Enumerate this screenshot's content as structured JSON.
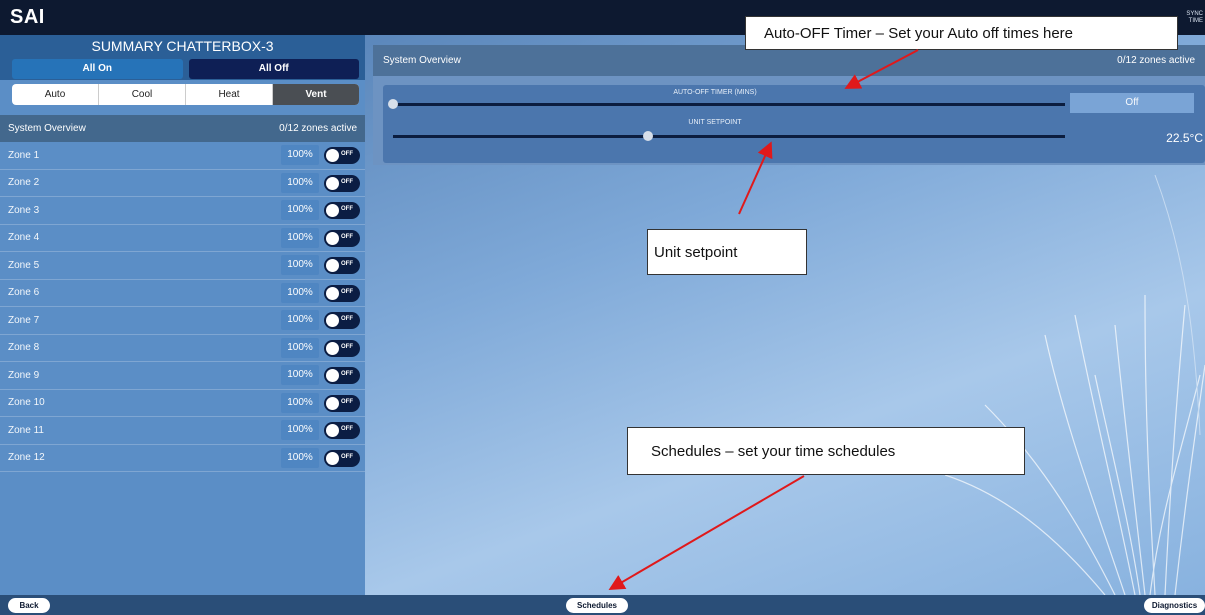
{
  "header": {
    "logo_text": "SAI",
    "brand_right": "SYNC\nTIME"
  },
  "sidebar": {
    "title": "SUMMARY CHATTERBOX-3",
    "all_on_label": "All On",
    "all_off_label": "All Off",
    "modes": [
      "Auto",
      "Cool",
      "Heat",
      "Vent"
    ],
    "active_mode": "Vent",
    "overview_label": "System Overview",
    "overview_status": "0/12 zones active",
    "zones": [
      {
        "name": "Zone 1",
        "percent": "100%",
        "state": "OFF"
      },
      {
        "name": "Zone 2",
        "percent": "100%",
        "state": "OFF"
      },
      {
        "name": "Zone 3",
        "percent": "100%",
        "state": "OFF"
      },
      {
        "name": "Zone 4",
        "percent": "100%",
        "state": "OFF"
      },
      {
        "name": "Zone 5",
        "percent": "100%",
        "state": "OFF"
      },
      {
        "name": "Zone 6",
        "percent": "100%",
        "state": "OFF"
      },
      {
        "name": "Zone 7",
        "percent": "100%",
        "state": "OFF"
      },
      {
        "name": "Zone 8",
        "percent": "100%",
        "state": "OFF"
      },
      {
        "name": "Zone 9",
        "percent": "100%",
        "state": "OFF"
      },
      {
        "name": "Zone 10",
        "percent": "100%",
        "state": "OFF"
      },
      {
        "name": "Zone 11",
        "percent": "100%",
        "state": "OFF"
      },
      {
        "name": "Zone 12",
        "percent": "100%",
        "state": "OFF"
      }
    ]
  },
  "main": {
    "overview_label": "System Overview",
    "overview_status": "0/12 zones active",
    "auto_off_label": "AUTO-OFF TIMER (MINS)",
    "auto_off_value": "Off",
    "auto_off_level": 0,
    "setpoint_label": "UNIT SETPOINT",
    "setpoint_value": "22.5°C",
    "setpoint_level": 0.38
  },
  "footer": {
    "back_label": "Back",
    "schedules_label": "Schedules",
    "diagnostics_label": "Diagnostics"
  },
  "annotations": {
    "auto_off": "Auto-OFF Timer – Set your Auto off times here",
    "setpoint": "Unit setpoint",
    "schedules": "Schedules – set your time schedules"
  },
  "colors": {
    "header": "#0d1930",
    "sidebar": "#5b8ec6",
    "toggle_off": "#0b1d43",
    "arrow": "#e0191b"
  }
}
